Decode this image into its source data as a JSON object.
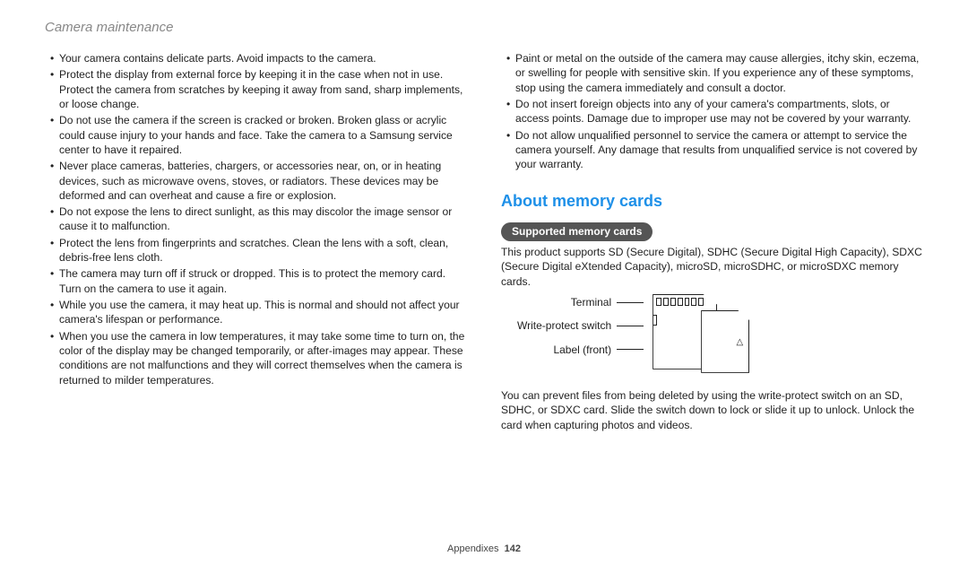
{
  "header": {
    "title": "Camera maintenance"
  },
  "left_bullets": [
    "Your camera contains delicate parts. Avoid impacts to the camera.",
    "Protect the display from external force by keeping it in the case when not in use. Protect the camera from scratches by keeping it away from sand, sharp implements, or loose change.",
    "Do not use the camera if the screen is cracked or broken. Broken glass or acrylic could cause injury to your hands and face. Take the camera to a Samsung service center to have it repaired.",
    "Never place cameras, batteries, chargers, or accessories near, on, or in heating devices, such as microwave ovens, stoves, or radiators. These devices may be deformed and can overheat and cause a fire or explosion.",
    "Do not expose the lens to direct sunlight, as this may discolor the image sensor or cause it to malfunction.",
    "Protect the lens from fingerprints and scratches. Clean the lens with a soft, clean, debris-free lens cloth.",
    "The camera may turn off if struck or dropped. This is to protect the memory card. Turn on the camera to use it again.",
    "While you use the camera, it may heat up. This is normal and should not affect your camera's lifespan or performance.",
    "When you use the camera in low temperatures, it may take some time to turn on, the color of the display may be changed temporarily, or after-images may appear. These conditions are not malfunctions and they will correct themselves when the camera is returned to milder temperatures."
  ],
  "right_bullets": [
    "Paint or metal on the outside of the camera may cause allergies, itchy skin, eczema, or swelling for people with sensitive skin. If you experience any of these symptoms, stop using the camera immediately and consult a doctor.",
    "Do not insert foreign objects into any of your camera's compartments, slots, or access points. Damage due to improper use may not be covered by your warranty.",
    "Do not allow unqualified personnel to service the camera or attempt to service the camera yourself. Any damage that results from unqualified service is not covered by your warranty."
  ],
  "memory": {
    "section_title": "About memory cards",
    "pill": "Supported memory cards",
    "intro": "This product supports SD (Secure Digital), SDHC (Secure Digital High Capacity), SDXC (Secure Digital eXtended Capacity), microSD, microSDHC, or microSDXC memory cards.",
    "diagram_labels": {
      "terminal": "Terminal",
      "wp": "Write-protect switch",
      "label": "Label (front)"
    },
    "footer_para": "You can prevent files from being deleted by using the write-protect switch on an SD, SDHC, or SDXC card. Slide the switch down to lock or slide it up to unlock. Unlock the card when capturing photos and videos."
  },
  "footer": {
    "section": "Appendixes",
    "page": "142"
  }
}
